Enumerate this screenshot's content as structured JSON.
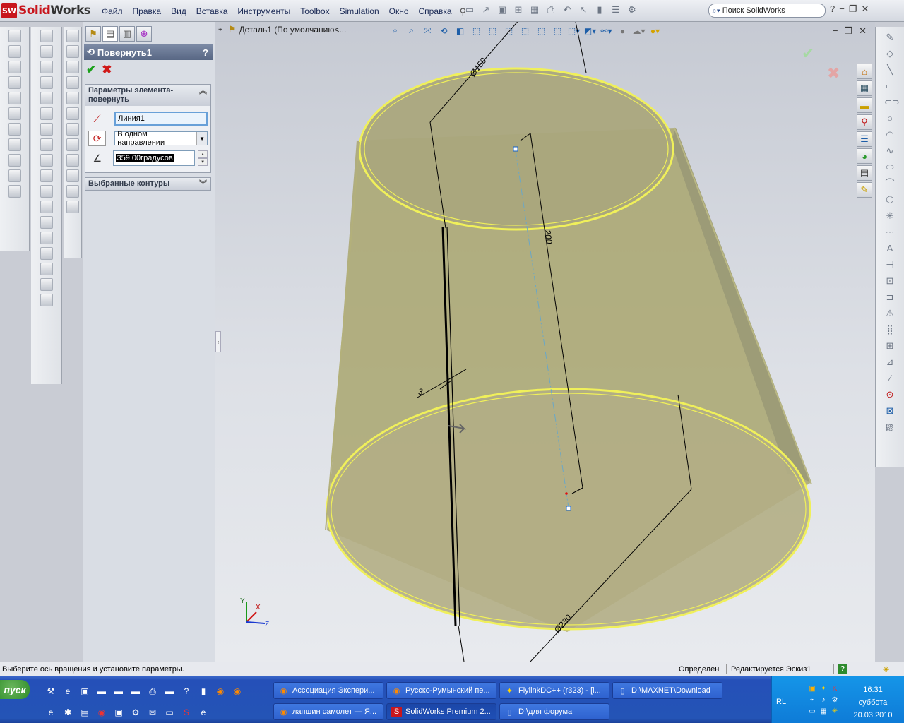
{
  "app": {
    "logo_text_a": "Solid",
    "logo_text_b": "Works",
    "logo_badge": "SW",
    "menu": [
      "Файл",
      "Правка",
      "Вид",
      "Вставка",
      "Инструменты",
      "Toolbox",
      "Simulation",
      "Окно",
      "Справка"
    ],
    "search_placeholder": "Поиск SolidWorks",
    "help_icon": "?"
  },
  "property_manager": {
    "title": "Повернуть1",
    "help": "?",
    "ok": "✔",
    "cancel": "✖",
    "params_group": {
      "title": "Параметры элемента-повернуть",
      "axis_value": "Линия1",
      "direction_value": "В одном направлении",
      "angle_value": "359.00градусов"
    },
    "contours_group": {
      "title": "Выбранные контуры"
    }
  },
  "viewport": {
    "tree_label": "Деталь1  (По умолчанию<...",
    "dimensions": {
      "top_diameter": "Ø150",
      "bottom_diameter": "Ø230",
      "height": "200",
      "thickness": "3"
    },
    "triad": {
      "x": "X",
      "y": "Y",
      "z": "Z"
    }
  },
  "status": {
    "message": "Выберите ось вращения и установите параметры.",
    "state": "Определен",
    "editing": "Редактируется Эскиз1",
    "help": "?"
  },
  "taskbar": {
    "start": "пуск",
    "row1": [
      {
        "label": "Ассоциация Экспери...",
        "icon": "firefox-icon"
      },
      {
        "label": "Русско-Румынский пе...",
        "icon": "firefox-icon"
      },
      {
        "label": "FlylinkDC++ (r323) - [l...",
        "icon": "flylink-icon"
      },
      {
        "label": "D:\\MAXNET\\Download",
        "icon": "folder-icon"
      }
    ],
    "row2": [
      {
        "label": "лапшин самолет — Я...",
        "icon": "firefox-icon"
      },
      {
        "label": "SolidWorks Premium 2...",
        "icon": "solidworks-icon"
      },
      {
        "label": "D:\\для форума",
        "icon": "folder-icon"
      }
    ],
    "lang": "RL",
    "time": "16:31",
    "weekday": "суббота",
    "date": "20.03.2010"
  },
  "colors": {
    "accent_yellow": "#f0f05a",
    "body_fill": "#a8a56e",
    "pm_header": "#5f6f8c",
    "taskbar": "#2454b6"
  }
}
